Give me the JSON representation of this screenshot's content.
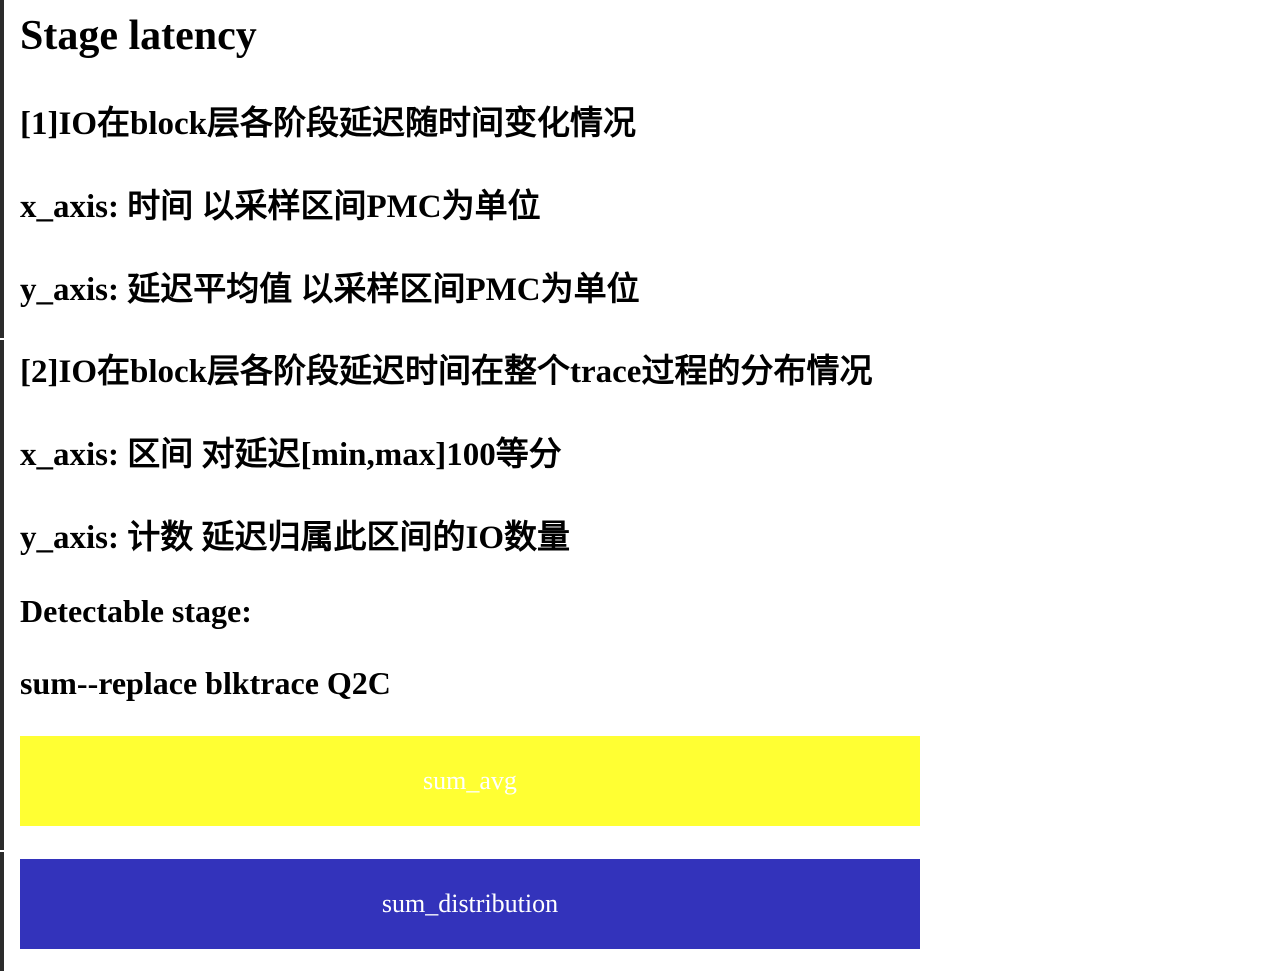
{
  "page": {
    "title": "Stage latency"
  },
  "description": {
    "chart1_heading": "[1]IO在block层各阶段延迟随时间变化情况",
    "chart1_x_axis": "x_axis: 时间 以采样区间PMC为单位",
    "chart1_y_axis": "y_axis: 延迟平均值 以采样区间PMC为单位",
    "chart2_heading": "[2]IO在block层各阶段延迟时间在整个trace过程的分布情况",
    "chart2_x_axis": "x_axis: 区间 对延迟[min,max]100等分",
    "chart2_y_axis": "y_axis: 计数 延迟归属此区间的IO数量"
  },
  "stages": {
    "label": "Detectable stage:",
    "sum_line": "sum--replace blktrace Q2C"
  },
  "buttons": {
    "sum_avg": {
      "label": "sum_avg",
      "color": "#ffff33"
    },
    "sum_distribution": {
      "label": "sum_distribution",
      "color": "#3333bb"
    }
  }
}
